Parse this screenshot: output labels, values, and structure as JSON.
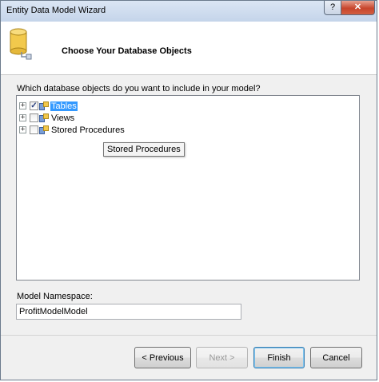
{
  "window": {
    "title": "Entity Data Model Wizard",
    "help_label": "?",
    "close_label": "✕"
  },
  "header": {
    "title": "Choose Your Database Objects"
  },
  "prompt": "Which database objects do you want to include in your model?",
  "tree": {
    "items": [
      {
        "label": "Tables",
        "checked": true,
        "selected": true,
        "expander": "+"
      },
      {
        "label": "Views",
        "checked": false,
        "selected": false,
        "expander": "+"
      },
      {
        "label": "Stored Procedures",
        "checked": false,
        "selected": false,
        "expander": "+"
      }
    ],
    "tooltip": "Stored Procedures"
  },
  "namespace": {
    "label": "Model Namespace:",
    "value": "ProfitModelModel"
  },
  "buttons": {
    "previous": "< Previous",
    "next": "Next >",
    "finish": "Finish",
    "cancel": "Cancel"
  },
  "colors": {
    "selection": "#3399ff",
    "close_button": "#c7452c",
    "title_bar": "#c4d4ea"
  },
  "icons": {
    "header": "database-icon",
    "tree_node": "database-object-icon"
  }
}
